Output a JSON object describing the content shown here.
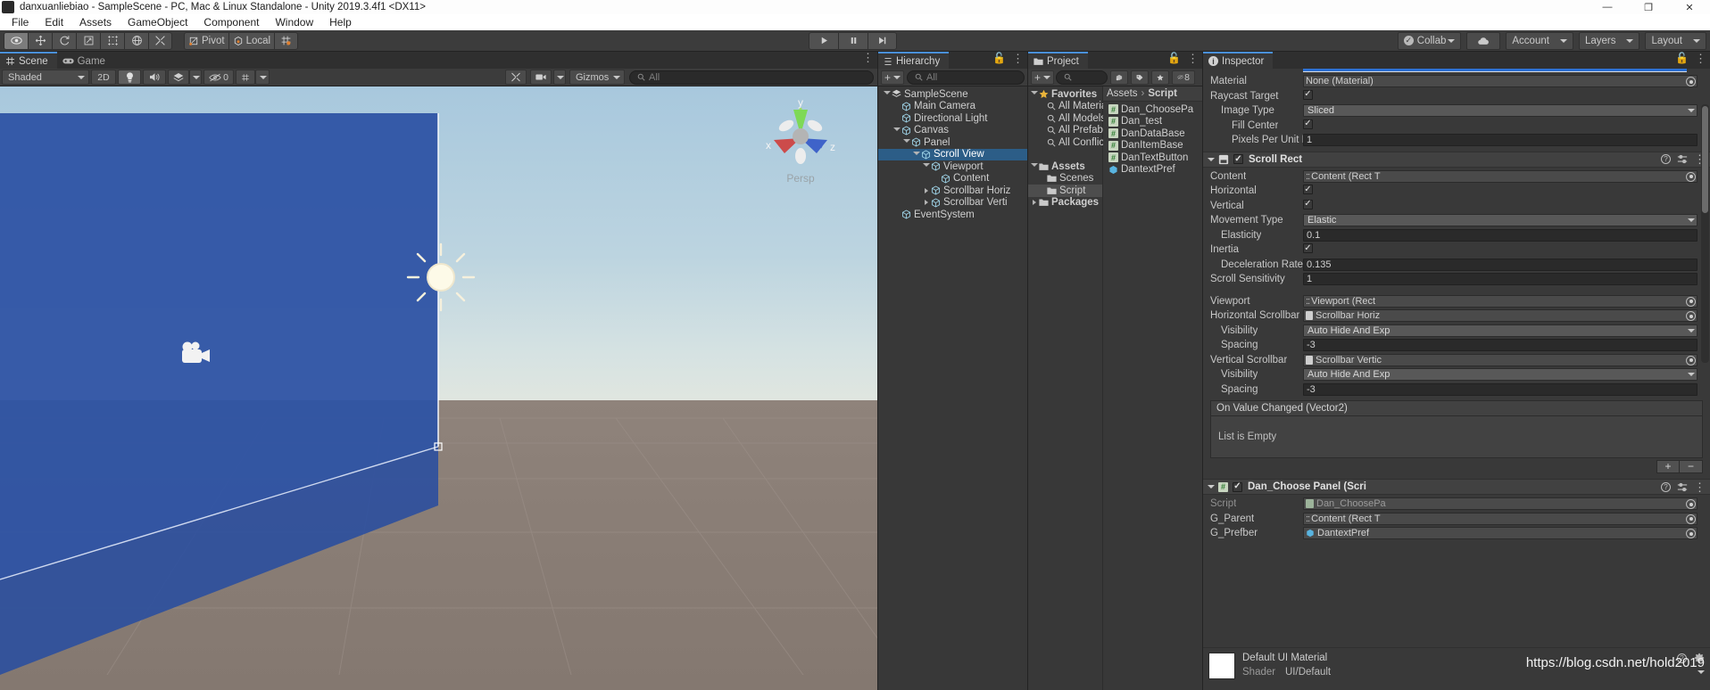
{
  "window": {
    "title": "danxuanliebiao - SampleScene - PC, Mac & Linux Standalone - Unity 2019.3.4f1 <DX11>",
    "minimize": "—",
    "maximize": "❐",
    "close": "✕"
  },
  "menu": {
    "items": [
      "File",
      "Edit",
      "Assets",
      "GameObject",
      "Component",
      "Window",
      "Help"
    ]
  },
  "toolbar": {
    "tools": [
      "hand-tool",
      "move-tool",
      "rotate-tool",
      "scale-tool",
      "rect-tool",
      "transform-tool",
      "custom-tool"
    ],
    "pivot_label": "Pivot",
    "space_label": "Local",
    "grid_label": "grid-snap",
    "play": "play-button",
    "pause": "pause-button",
    "step": "step-button",
    "collab_label": "Collab",
    "cloud_label": "cloud-icon",
    "account_label": "Account",
    "layers_label": "Layers",
    "layout_label": "Layout"
  },
  "scene": {
    "tabs": [
      {
        "label": "Scene",
        "icon": "scene-grid-icon",
        "active": true
      },
      {
        "label": "Game",
        "icon": "gamepad-icon",
        "active": false
      }
    ],
    "shading_mode": "Shaded",
    "mode_2d": "2D",
    "lighting": "lighting-icon",
    "audio": "audio-icon",
    "fx": "fx-icon",
    "hidden_count": "0",
    "grid": "grid-icon",
    "tools_icon": "scene-tools-icon",
    "camera_icon": "scene-camera-icon",
    "gizmos_label": "Gizmos",
    "search_placeholder": "All",
    "axis_x": "x",
    "axis_y": "y",
    "axis_z": "z",
    "persp_label": "Persp"
  },
  "hierarchy": {
    "tab_label": "Hierarchy",
    "add_label": "+",
    "search_placeholder": "All",
    "items": [
      {
        "label": "SampleScene",
        "depth": 0,
        "icon": "scene-icon",
        "arrow": "open",
        "selected": false
      },
      {
        "label": "Main Camera",
        "depth": 1,
        "icon": "gameobject-icon",
        "arrow": "",
        "selected": false
      },
      {
        "label": "Directional Light",
        "depth": 1,
        "icon": "gameobject-icon",
        "arrow": "",
        "selected": false
      },
      {
        "label": "Canvas",
        "depth": 1,
        "icon": "gameobject-icon",
        "arrow": "open",
        "selected": false
      },
      {
        "label": "Panel",
        "depth": 2,
        "icon": "gameobject-icon",
        "arrow": "open",
        "selected": false
      },
      {
        "label": "Scroll View",
        "depth": 3,
        "icon": "gameobject-icon",
        "arrow": "open",
        "selected": true
      },
      {
        "label": "Viewport",
        "depth": 4,
        "icon": "gameobject-icon",
        "arrow": "open",
        "selected": false
      },
      {
        "label": "Content",
        "depth": 5,
        "icon": "gameobject-icon",
        "arrow": "",
        "selected": false
      },
      {
        "label": "Scrollbar Horiz",
        "depth": 4,
        "icon": "gameobject-icon",
        "arrow": "closed",
        "selected": false
      },
      {
        "label": "Scrollbar Verti",
        "depth": 4,
        "icon": "gameobject-icon",
        "arrow": "closed",
        "selected": false
      },
      {
        "label": "EventSystem",
        "depth": 1,
        "icon": "gameobject-icon",
        "arrow": "",
        "selected": false
      }
    ]
  },
  "project": {
    "tab_label": "Project",
    "add_label": "+",
    "search_placeholder": "",
    "visible_count": "8",
    "breadcrumb": [
      "Assets",
      "Script"
    ],
    "tree": [
      {
        "label": "Favorites",
        "depth": 0,
        "icon": "star-icon",
        "arrow": "open",
        "bold": true,
        "selected": false
      },
      {
        "label": "All Materia",
        "depth": 1,
        "icon": "search-icon",
        "arrow": "",
        "bold": false,
        "selected": false
      },
      {
        "label": "All Models",
        "depth": 1,
        "icon": "search-icon",
        "arrow": "",
        "bold": false,
        "selected": false
      },
      {
        "label": "All Prefabs",
        "depth": 1,
        "icon": "search-icon",
        "arrow": "",
        "bold": false,
        "selected": false
      },
      {
        "label": "All Conflict",
        "depth": 1,
        "icon": "search-icon",
        "arrow": "",
        "bold": false,
        "selected": false
      },
      {
        "label": "",
        "depth": 0,
        "icon": "",
        "arrow": "",
        "bold": false,
        "selected": false
      },
      {
        "label": "Assets",
        "depth": 0,
        "icon": "folder-icon",
        "arrow": "open",
        "bold": true,
        "selected": false
      },
      {
        "label": "Scenes",
        "depth": 1,
        "icon": "folder-icon",
        "arrow": "",
        "bold": false,
        "selected": false
      },
      {
        "label": "Script",
        "depth": 1,
        "icon": "folder-icon",
        "arrow": "",
        "bold": false,
        "selected": true
      },
      {
        "label": "Packages",
        "depth": 0,
        "icon": "folder-icon",
        "arrow": "closed",
        "bold": true,
        "selected": false
      }
    ],
    "files": [
      {
        "label": "Dan_ChoosePa",
        "icon": "csharp-script-icon"
      },
      {
        "label": "Dan_test",
        "icon": "csharp-script-icon"
      },
      {
        "label": "DanDataBase",
        "icon": "csharp-script-icon"
      },
      {
        "label": "DanItemBase",
        "icon": "csharp-script-icon"
      },
      {
        "label": "DanTextButton",
        "icon": "csharp-script-icon"
      },
      {
        "label": "DantextPref",
        "icon": "prefab-icon"
      }
    ]
  },
  "inspector": {
    "tab_label": "Inspector",
    "image_props": [
      {
        "label": "Material",
        "type": "object",
        "value": "None (Material)",
        "indent": 0
      },
      {
        "label": "Raycast Target",
        "type": "check",
        "value": "✓",
        "indent": 0
      },
      {
        "label": "Image Type",
        "type": "dropdown",
        "value": "Sliced",
        "indent": 1
      },
      {
        "label": "Fill Center",
        "type": "check",
        "value": "✓",
        "indent": 2
      },
      {
        "label": "Pixels Per Unit Mul",
        "type": "text",
        "value": "1",
        "indent": 2
      }
    ],
    "scroll_rect": {
      "title": "Scroll Rect",
      "enabled": "✓",
      "props": [
        {
          "label": "Content",
          "type": "object",
          "value": ":: Content (Rect T",
          "indent": 0
        },
        {
          "label": "Horizontal",
          "type": "check",
          "value": "✓",
          "indent": 0
        },
        {
          "label": "Vertical",
          "type": "check",
          "value": "✓",
          "indent": 0
        },
        {
          "label": "Movement Type",
          "type": "dropdown",
          "value": "Elastic",
          "indent": 0
        },
        {
          "label": "Elasticity",
          "type": "text",
          "value": "0.1",
          "indent": 1
        },
        {
          "label": "Inertia",
          "type": "check",
          "value": "✓",
          "indent": 0
        },
        {
          "label": "Deceleration Rate",
          "type": "text",
          "value": "0.135",
          "indent": 1
        },
        {
          "label": "Scroll Sensitivity",
          "type": "text",
          "value": "1",
          "indent": 0
        },
        {
          "label": "",
          "type": "spacer",
          "value": "",
          "indent": 0
        },
        {
          "label": "Viewport",
          "type": "object",
          "value": ":: Viewport (Rect",
          "indent": 0
        },
        {
          "label": "Horizontal Scrollbar",
          "type": "object",
          "value": "Scrollbar Horiz",
          "indent": 0
        },
        {
          "label": "Visibility",
          "type": "dropdown",
          "value": "Auto Hide And Exp",
          "indent": 1
        },
        {
          "label": "Spacing",
          "type": "text",
          "value": "-3",
          "indent": 1
        },
        {
          "label": "Vertical Scrollbar",
          "type": "object",
          "value": "Scrollbar Vertic",
          "indent": 0
        },
        {
          "label": "Visibility",
          "type": "dropdown",
          "value": "Auto Hide And Exp",
          "indent": 1
        },
        {
          "label": "Spacing",
          "type": "text",
          "value": "-3",
          "indent": 1
        }
      ],
      "event_title": "On Value Changed (Vector2)",
      "event_empty": "List is Empty",
      "add_btn": "+",
      "remove_btn": "−"
    },
    "script_comp": {
      "title": "Dan_Choose Panel (Scri",
      "enabled": "✓",
      "props": [
        {
          "label": "Script",
          "type": "object",
          "value": "Dan_ChoosePa",
          "indent": 0,
          "dim": true
        },
        {
          "label": "G_Parent",
          "type": "object",
          "value": ":: Content (Rect T",
          "indent": 0,
          "dim": false
        },
        {
          "label": "G_Prefber",
          "type": "object",
          "value": "DantextPref",
          "indent": 0,
          "dim": false
        }
      ]
    },
    "material": {
      "name": "Default UI Material",
      "shader_label": "Shader",
      "shader_value": "UI/Default"
    }
  },
  "watermark": "https://blog.csdn.net/hold2019",
  "colors": {
    "selection_blue": "#2c5d87",
    "tab_accent": "#4a90d9",
    "floor": "#8d817a",
    "wall_blue": "#2b4f9e"
  }
}
